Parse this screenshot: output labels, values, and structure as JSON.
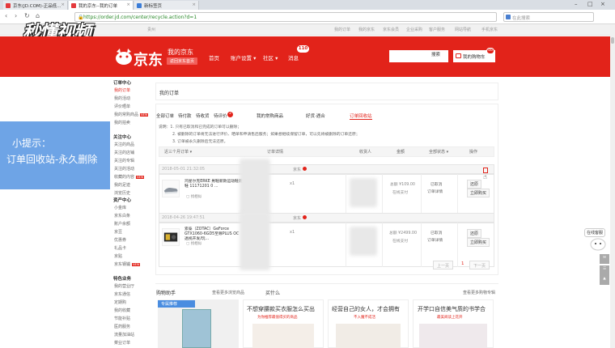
{
  "browser": {
    "tabs": [
      {
        "label": "京东(JD.COM)-正品低..."
      },
      {
        "label": "我的京东--我的订单"
      },
      {
        "label": "新标签页"
      }
    ],
    "url": "https://order.jd.com/center/recycle.action?d=1",
    "search_placeholder": "在此搜索"
  },
  "watermark": "秒懂视频",
  "topbar": {
    "location": "贵州",
    "links": [
      "我的订单",
      "我的京东",
      "京东会员",
      "企业采购",
      "客户服务",
      "网站导航",
      "手机京东"
    ]
  },
  "header": {
    "logo": "京东",
    "mine": "我的京东",
    "home_button": "返回京东首页",
    "nav": [
      "首页",
      "账户设置",
      "社区",
      "消息"
    ],
    "msg_count": "110",
    "search_button": "搜索",
    "cart_label": "我的购物车",
    "cart_count": "46"
  },
  "sidebar": {
    "sections": [
      {
        "title": "订单中心",
        "items": [
          "我的订单",
          "我的活动",
          "评价晒单",
          "我的常购商品",
          "我的拍卖"
        ]
      },
      {
        "title": "关注中心",
        "items": [
          "关注的商品",
          "关注的店铺",
          "关注的专辑",
          "关注的活动",
          "收藏的内容",
          "我的足迹",
          "浏览历史"
        ]
      },
      {
        "title": "资产中心",
        "items": [
          "小金库",
          "京东白条",
          "账户余额",
          "京豆",
          "优惠券",
          "礼品卡",
          "京贴",
          "京东钢镚"
        ]
      },
      {
        "title": "特色业务",
        "items": [
          "我的营业厅",
          "京东通信",
          "定期购",
          "我的收藏",
          "节能补贴",
          "医药服务",
          "流量加油站",
          "菜业订单"
        ]
      }
    ],
    "new_tag": "NEW"
  },
  "tip": {
    "title": "小提示：",
    "body": "订单回收站-永久删除"
  },
  "main": {
    "title": "我的订单",
    "filters": [
      "全部订单",
      "待付款",
      "待收货",
      "待评价",
      "我的常购商品",
      "好货·遇合",
      "订单回收站"
    ],
    "pending_review_badge": "2",
    "notes": [
      "说明：1. 只有已取消和已完成的订单可以删除；",
      "2. 被删除的订单将无法进行评价、晒单和申请售后服务；如果想继续保留订单，可以先将被删除的订单还原；",
      "3. 订单被永久删除后无法还原。"
    ],
    "columns": [
      "近三个月订单",
      "订单详情",
      "收货人",
      "金额",
      "全部状态",
      "操作"
    ],
    "orders": [
      {
        "time": "2018-05-01 21:32:05",
        "shop": "京东",
        "product": "鸿星尔克ERKE 男鞋新款运动鞋跑鞋 11171201 0 ...",
        "qty": "x1",
        "price": "总额 ¥109.00",
        "pay": "在线支付",
        "status": "已取消",
        "detail": "订单详情",
        "actions": [
          "还原",
          "立即购买"
        ],
        "similar": "找相似"
      },
      {
        "time": "2018-04-26 19:47:51",
        "shop": "京东",
        "product": "索泰（ZOTAC）GeForce GTX1060-6GD5至尊PLUS OC 透视开发/玩...",
        "qty": "x1",
        "price": "总额 ¥2499.00",
        "pay": "在线支付",
        "status": "已取消",
        "detail": "订单详情",
        "actions": [
          "还原",
          "立即购买"
        ],
        "similar": "找相似"
      }
    ],
    "pager": {
      "prev": "上一页",
      "current": "1",
      "next": "下一页"
    }
  },
  "helper": {
    "title": "购物助手",
    "more1": "查看更多浏览商品",
    "title2": "买什么",
    "more2": "查看更多购物专辑",
    "badge": "专属推荐",
    "cards": [
      {
        "title": "不想穿腰款买衣服怎么买出",
        "sub": "为你推荐最值得买的商品"
      },
      {
        "title": "经营自己的女人，才会拥有",
        "sub": "不入魔不成活"
      },
      {
        "title": "开学口自信美气质的书学合",
        "sub": "最美阅读上花开"
      }
    ]
  },
  "rightpanel": {
    "bubble": "在线客服"
  }
}
